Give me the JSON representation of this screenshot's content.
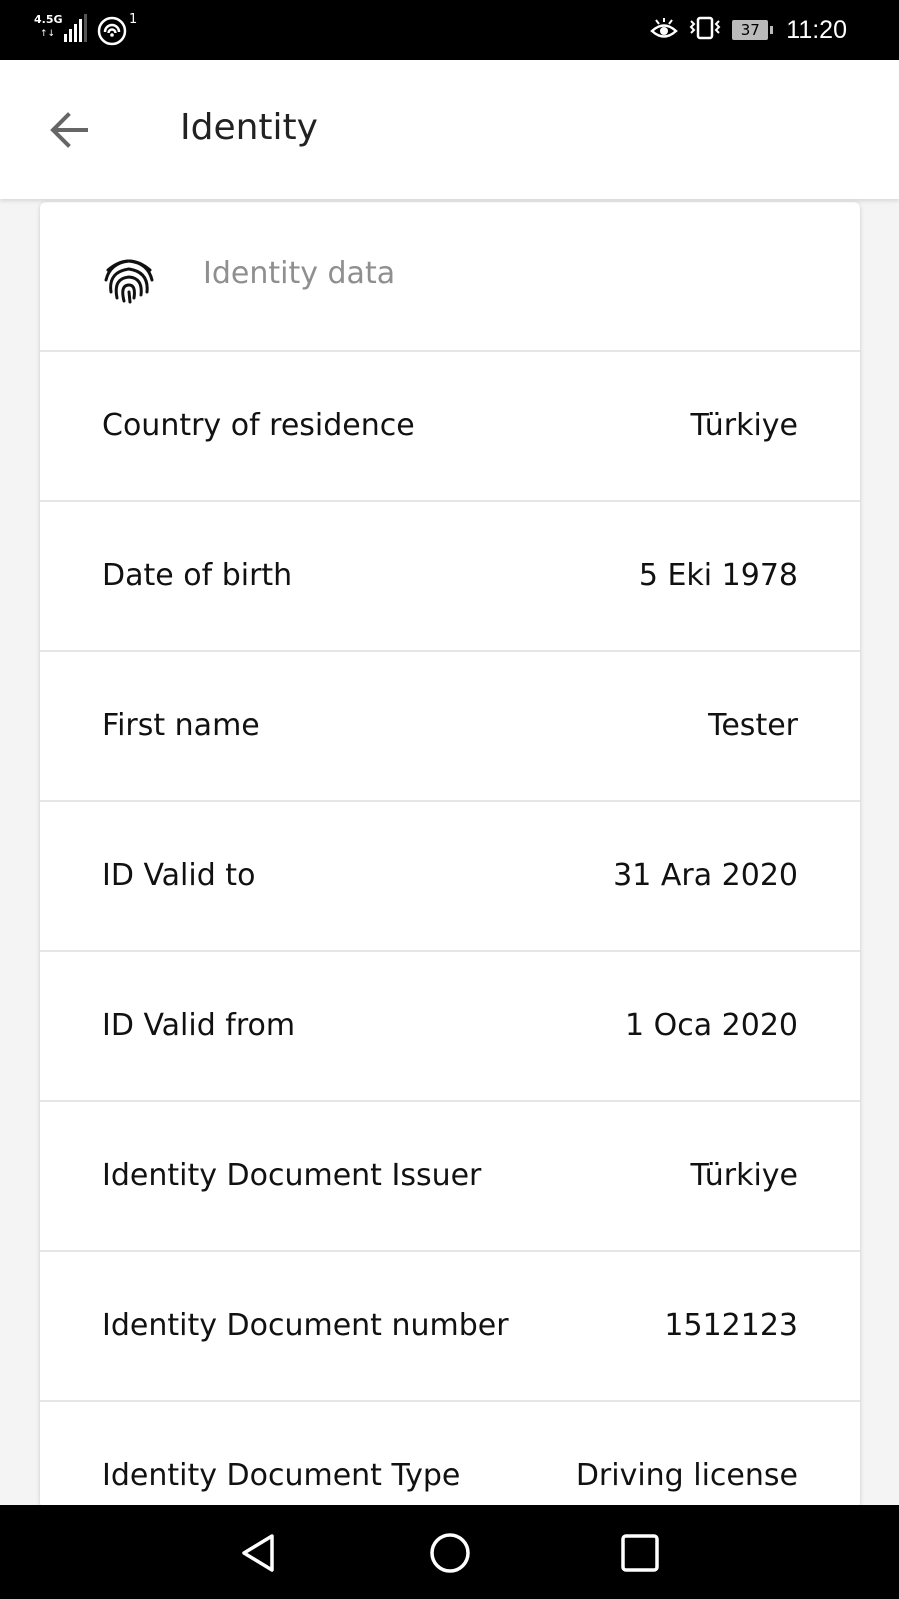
{
  "status_bar": {
    "network_type": "4.5G",
    "hotspot_count": "1",
    "battery_level": "37",
    "time": "11:20",
    "icons": [
      "signal-icon",
      "hotspot-icon",
      "eye-comfort-icon",
      "vibrate-icon",
      "battery-icon"
    ]
  },
  "app_bar": {
    "title": "Identity",
    "back_icon": "arrow-left-icon"
  },
  "card": {
    "header_icon": "fingerprint-icon",
    "section_title": "Identity data",
    "rows": [
      {
        "label": "Country of residence",
        "value": "Türkiye"
      },
      {
        "label": "Date of birth",
        "value": "5 Eki 1978"
      },
      {
        "label": "First name",
        "value": "Tester"
      },
      {
        "label": "ID Valid to",
        "value": "31 Ara 2020"
      },
      {
        "label": "ID Valid from",
        "value": "1 Oca 2020"
      },
      {
        "label": "Identity Document Issuer",
        "value": "Türkiye"
      },
      {
        "label": "Identity Document number",
        "value": "1512123"
      },
      {
        "label": "Identity Document Type",
        "value": "Driving license"
      }
    ]
  },
  "nav_bar": {
    "icons": [
      "nav-back-icon",
      "nav-home-icon",
      "nav-recents-icon"
    ]
  }
}
